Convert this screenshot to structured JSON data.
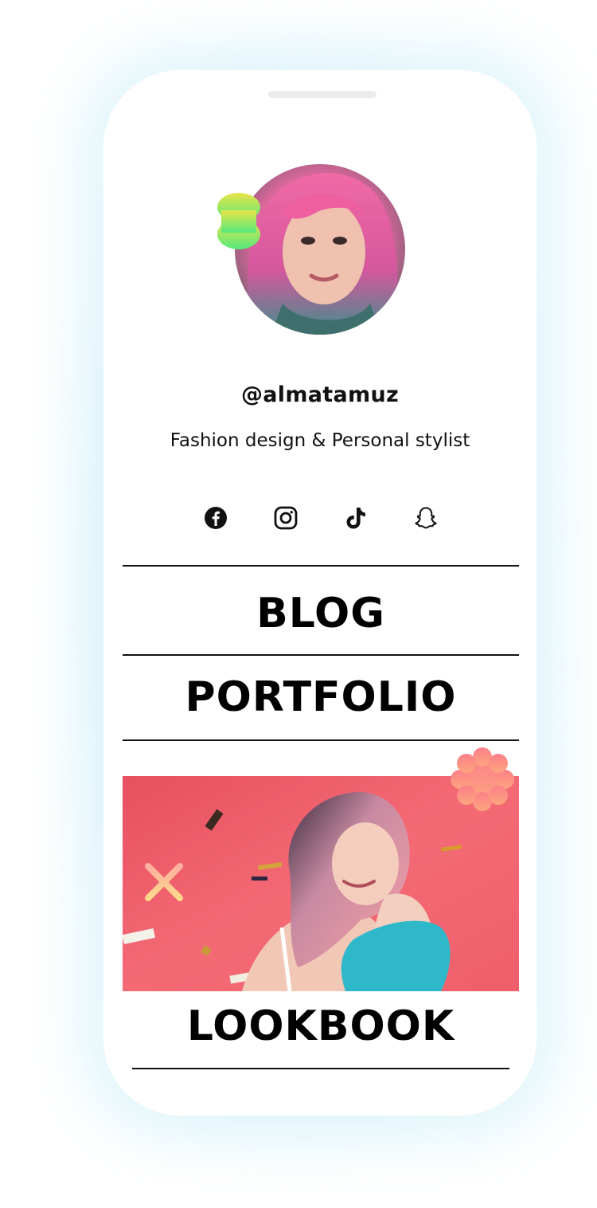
{
  "profile": {
    "username": "@almatamuz",
    "bio": "Fashion design & Personal stylist"
  },
  "socials": [
    {
      "icon": "facebook-icon"
    },
    {
      "icon": "instagram-icon"
    },
    {
      "icon": "tiktok-icon"
    },
    {
      "icon": "snapchat-icon"
    }
  ],
  "links": {
    "blog": "BLOG",
    "portfolio": "PORTFOLIO",
    "lookbook": "LOOKBOOK"
  },
  "colors": {
    "background_glow": "#bfe9f6",
    "text": "#111111",
    "lookbook_bg": "#f0646f",
    "blob_top": "#e6e44a",
    "blob_bottom": "#5fe87a",
    "badge": "#fa8d86"
  }
}
